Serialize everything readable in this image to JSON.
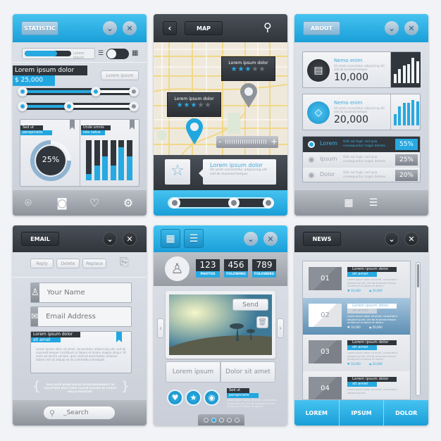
{
  "statistic": {
    "title": "STATISTIC",
    "progress_label": "Lorem ipsum",
    "progress": 0.7,
    "heading": "Lorem ipsum dolor",
    "price": "$ 25,000",
    "button": "Lorem ipsum",
    "sliders": [
      0.66,
      0.42
    ],
    "donut": {
      "label1": "Sed ut",
      "label2": "perspiciatis",
      "value": "25%",
      "fraction": 0.25
    },
    "bars": {
      "label1": "Unde omnis",
      "label2": "iste natus",
      "levels": [
        0.15,
        0.37,
        0.6,
        0.37,
        0.82,
        0.6
      ]
    },
    "footer_icons": [
      "map-pin-icon",
      "camera-icon",
      "heart-icon",
      "gear-icon"
    ]
  },
  "map": {
    "title": "MAP",
    "callouts": [
      {
        "title": "Lorem ipsum dolor",
        "rating": 3,
        "max": 5
      },
      {
        "title": "Lorem ipsum dolor",
        "rating": 3,
        "max": 5
      }
    ],
    "zoom_minus": "-",
    "zoom_plus": "+",
    "info_title": "Lorem ipsum dolor",
    "info_text": "Sit amet consectetur adipisicing elit sed do eiusmod tempor",
    "range_handles": [
      0,
      0.6,
      0.95
    ]
  },
  "about": {
    "title": "ABOUT",
    "cards": [
      {
        "title": "Nemo enim",
        "text": "Sit amet consectetur adipisicing elit sed do eiusmod tempor",
        "value": "10,000",
        "icon": "clipboard-icon",
        "bars": [
          0.35,
          0.55,
          0.7,
          0.75,
          1,
          0.85
        ]
      },
      {
        "title": "Nemo enim",
        "text": "Sit amet consectetur adipisicing elit sed do eiusmod tempor",
        "value": "20,000",
        "icon": "diamond-icon",
        "bars": [
          0.45,
          0.75,
          0.9,
          0.9,
          1,
          0.95
        ]
      }
    ],
    "options": [
      {
        "label": "Lorem",
        "text": "Odit aut fugit, sed quia consequuntur magni dolores",
        "value": "55%",
        "selected": true
      },
      {
        "label": "Ipsum",
        "text": "Odit aut fugit, sed quia consequuntur magni dolores",
        "value": "25%",
        "selected": false
      },
      {
        "label": "Dolor",
        "text": "Odit aut fugit, sed quia consequuntur magni dolores",
        "value": "20%",
        "selected": false
      }
    ]
  },
  "email": {
    "title": "EMAIL",
    "actions": [
      "Reply",
      "Delete",
      "Replace"
    ],
    "name_placeholder": "Your Name",
    "email_placeholder": "Email Address",
    "message_title": "Lorem ipsum dolor",
    "message_sub": "sit amet",
    "message_body": "Lorem ipsum dolor sit amet, consectetur adipisicing elit, sed do eiusmod tempor incididunt ut labore et dolore magna aliqua. Ut enim ad minim veniam, quis nostrud exercitation ullamco laboris nisi ut aliquip ex ea commodo consequat.",
    "quote": "DUIS AUTE IRURE DOLOR IN REPREHENDERIT IN VOLUPTATE VELIT ESSE CILLUM DOLORE EU FUGIAT NULLA PARIATUR.",
    "search_placeholder": "_Search"
  },
  "profile": {
    "stats": [
      {
        "value": "123",
        "label": "PHOTOS"
      },
      {
        "value": "456",
        "label": "FOLOWING"
      },
      {
        "value": "789",
        "label": "FOLOWERS"
      }
    ],
    "send": "Send",
    "buttons": [
      "Lorem ipsum",
      "Dolor sit amet"
    ],
    "label1": "Sed ut",
    "label2": "perspiciatis",
    "text": "Lorem ipsum dolor sit amet, consectetur adipisicing elit, sed do eiusmod tempor incididunt ut labore et dolore.",
    "pages": 5,
    "active_page": 2
  },
  "news": {
    "title": "NEWS",
    "items": [
      {
        "num": "01",
        "title": "Lorem ipsum dolor",
        "sub": "sit amet",
        "text": "Lorem ipsum dolor sit amet, consectetur adipisicing elit, sed do eiusmod tempor incididunt ut labore et dolore.",
        "likes": "10,000",
        "views": "20,000"
      },
      {
        "num": "02",
        "title": "Lorem ipsum dolor",
        "sub": "sit amet",
        "text": "Lorem ipsum dolor sit amet, consectetur adipisicing elit, sed do eiusmod tempor incididunt ut labore et dolore.",
        "likes": "10,000",
        "views": "20,000",
        "selected": true
      },
      {
        "num": "03",
        "title": "Lorem ipsum dolor",
        "sub": "sit amet",
        "text": "Lorem ipsum dolor sit amet, consectetur adipisicing elit, sed do eiusmod tempor incididunt ut labore et dolore.",
        "likes": "10,000",
        "views": "20,000"
      },
      {
        "num": "04",
        "title": "Lorem ipsum dolor",
        "sub": "sit amet",
        "text": "Lorem ipsum dolor sit amet, consectetur adipisicing elit."
      }
    ],
    "tabs": [
      "LOREM",
      "IPSUM",
      "DOLOR"
    ]
  },
  "colors": {
    "accent": "#21a7e0",
    "dark": "#30353b",
    "panel": "#d5d9e0"
  }
}
